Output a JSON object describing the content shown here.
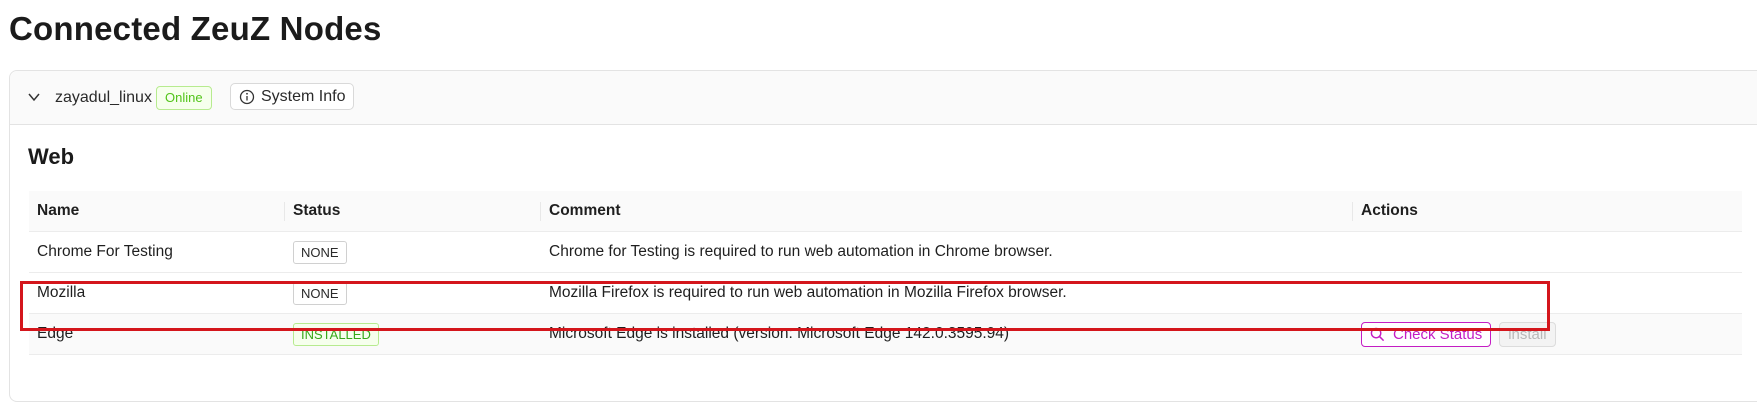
{
  "page": {
    "title": "Connected ZeuZ Nodes"
  },
  "node": {
    "name": "zayadul_linux",
    "status": "Online",
    "system_info_label": "System Info"
  },
  "section": {
    "title": "Web"
  },
  "table": {
    "columns": [
      "Name",
      "Status",
      "Comment",
      "Actions"
    ],
    "rows": [
      {
        "name": "Chrome For Testing",
        "status": "NONE",
        "comment": "Chrome for Testing is required to run web automation in Chrome browser."
      },
      {
        "name": "Mozilla",
        "status": "NONE",
        "comment": "Mozilla Firefox is required to run web automation in Mozilla Firefox browser."
      },
      {
        "name": "Edge",
        "status": "INSTALLED",
        "comment": "Microsoft Edge is installed (version: Microsoft Edge 142.0.3595.94)",
        "actions": {
          "check_status": "Check Status",
          "install": "install"
        }
      }
    ]
  },
  "icons": {
    "chevron": "chevron-down-icon",
    "info": "info-icon",
    "search": "search-icon"
  },
  "colors": {
    "online": "#52c41a",
    "installed": "#38a81a",
    "accent": "#c41dc4",
    "highlight": "#d4161c"
  }
}
